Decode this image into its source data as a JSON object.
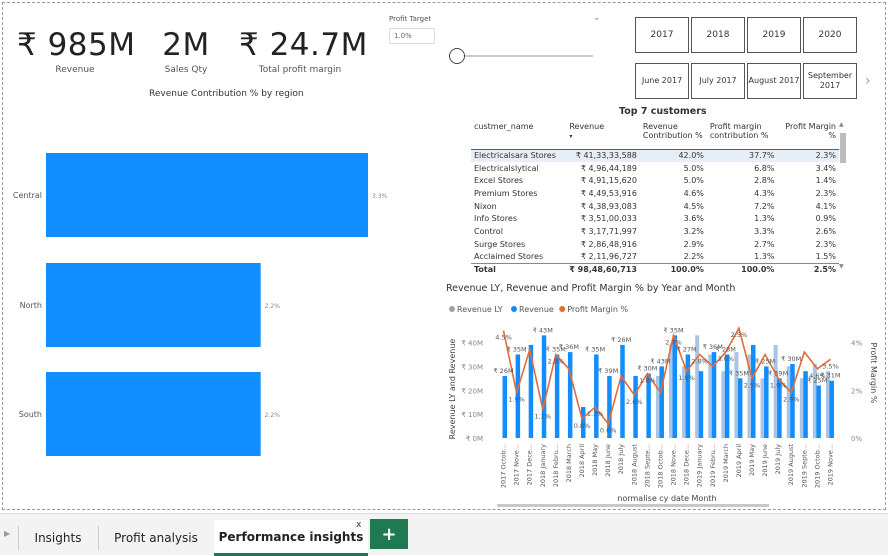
{
  "kpis": [
    {
      "value": "₹ 985M",
      "label": "Revenue"
    },
    {
      "value": "2M",
      "label": "Sales Qty"
    },
    {
      "value": "₹ 24.7M",
      "label": "Total profit margin"
    }
  ],
  "profit_target": {
    "title": "Profit Target",
    "value": "1.0%",
    "chevron": "⌄"
  },
  "years": [
    "2017",
    "2018",
    "2019",
    "2020"
  ],
  "months": [
    "June 2017",
    "July 2017",
    "August 2017",
    "September 2017"
  ],
  "months_next_icon": "chevron-right-icon",
  "region_chart": {
    "title": "Revenue Contribution % by region"
  },
  "customers": {
    "title": "Top 7 customers",
    "headers": [
      "custmer_name",
      "Revenue",
      "Revenue Contribution %",
      "Profit margin contribution %",
      "Profit Margin %"
    ],
    "rows": [
      [
        "Electricalsara Stores",
        "₹ 41,33,33,588",
        "42.0%",
        "37.7%",
        "2.3%"
      ],
      [
        "Electricalslytical",
        "₹ 4,96,44,189",
        "5.0%",
        "6.8%",
        "3.4%"
      ],
      [
        "Excel Stores",
        "₹ 4,91,15,620",
        "5.0%",
        "2.8%",
        "1.4%"
      ],
      [
        "Premium Stores",
        "₹ 4,49,53,916",
        "4.6%",
        "4.3%",
        "2.3%"
      ],
      [
        "Nixon",
        "₹ 4,38,93,083",
        "4.5%",
        "7.2%",
        "4.1%"
      ],
      [
        "Info Stores",
        "₹ 3,51,00,033",
        "3.6%",
        "1.3%",
        "0.9%"
      ],
      [
        "Control",
        "₹ 3,17,71,997",
        "3.2%",
        "3.3%",
        "2.6%"
      ],
      [
        "Surge Stores",
        "₹ 2,86,48,916",
        "2.9%",
        "2.7%",
        "2.3%"
      ],
      [
        "Acclaimed Stores",
        "₹ 2,11,96,727",
        "2.2%",
        "1.3%",
        "1.5%"
      ]
    ],
    "total": [
      "Total",
      "₹ 98,48,60,713",
      "100.0%",
      "100.0%",
      "2.5%"
    ]
  },
  "combo_chart": {
    "title": "Revenue LY, Revenue and Profit Margin % by Year and Month",
    "legend": [
      "Revenue LY",
      "Revenue",
      "Profit Margin %"
    ],
    "ylabel": "Revenue LY and Revenue",
    "y2label": "Profit Margin %",
    "xlabel": "normalise cy date Month"
  },
  "tabs": [
    "Insights",
    "Profit analysis",
    "Performance insights"
  ],
  "tab_close": "x",
  "add_tab": "+",
  "colors": {
    "blue": "#118dff",
    "lightblue": "#a9c4e4",
    "orange": "#e66c37",
    "grey": "#a0a0a0",
    "green": "#1f7a52"
  },
  "chart_data": [
    {
      "type": "bar",
      "title": "Revenue Contribution % by region",
      "categories": [
        "Central",
        "North",
        "South"
      ],
      "values": [
        3.3,
        2.2,
        2.2
      ],
      "labels": [
        "3.3%",
        "2.2%",
        "2.2%"
      ],
      "orientation": "horizontal"
    },
    {
      "type": "bar",
      "title": "Revenue LY, Revenue and Profit Margin % by Year and Month",
      "categories": [
        "2017 Octob...",
        "2017 Nove...",
        "2017 Dece...",
        "2018 January",
        "2018 Febru...",
        "2018 March",
        "2018 April",
        "2018 May",
        "2018 June",
        "2018 July",
        "2018 August",
        "2018 Septe...",
        "2018 Octob...",
        "2018 Nove...",
        "2018 Dece...",
        "2019 January",
        "2019 Febru...",
        "2019 March",
        "2019 April",
        "2019 May",
        "2019 June",
        "2019 July",
        "2019 August",
        "2019 Septe...",
        "2019 Octob...",
        "2019 Nove..."
      ],
      "y_ticks": [
        "₹ 0M",
        "₹ 10M",
        "₹ 20M",
        "₹ 30M",
        "₹ 40M"
      ],
      "y2_ticks": [
        "0%",
        "2%",
        "4%"
      ],
      "ylim": [
        0,
        44
      ],
      "y2lim": [
        0,
        4.4
      ],
      "series": [
        {
          "name": "Revenue LY",
          "values": [
            0,
            0,
            0,
            0,
            0,
            0,
            0,
            0,
            0,
            0,
            0,
            0,
            26,
            39,
            30,
            43,
            35,
            28,
            36,
            35,
            25,
            39,
            30,
            25,
            31,
            28
          ]
        },
        {
          "name": "Revenue",
          "values": [
            26,
            35,
            39,
            43,
            35,
            36,
            13,
            35,
            26,
            39,
            26,
            27,
            30,
            43,
            35,
            28,
            36,
            35,
            25,
            39,
            30,
            25,
            31,
            28,
            22,
            24
          ]
        },
        {
          "name": "Profit Margin %",
          "values": [
            4.5,
            1.9,
            3.7,
            1.2,
            3.5,
            2.9,
            0.8,
            1.3,
            0.6,
            2.6,
            1.8,
            2.7,
            1.9,
            4.3,
            2.8,
            3.5,
            3.0,
            3.6,
            4.6,
            2.5,
            3.5,
            2.5,
            1.9,
            3.6,
            2.9,
            3.3
          ]
        }
      ],
      "data_labels": [
        "₹ 26M",
        "₹ 35M",
        "₹ 43M",
        "₹ 35M",
        "₹ 36M",
        "₹ 35M",
        "₹ 39M",
        "₹ 26M",
        "₹ 30M",
        "₹ 43M",
        "₹ 35M",
        "₹ 27M",
        "₹ 36M",
        "₹ 28M",
        "₹ 35M",
        "₹ 25M",
        "₹ 39M",
        "₹ 30M",
        "₹ 25M",
        "₹ 31M",
        "4.5%",
        "1.9%",
        "1.2%",
        "2.9%",
        "0.8%",
        "1.3%",
        "0.6%",
        "2.6%",
        "1.8%",
        "2.7%",
        "1.9%",
        "2.8%",
        "3.0%",
        "2.5%",
        "2.5%",
        "1.9%",
        "2.9%",
        "4.6%",
        "3.5%"
      ]
    }
  ]
}
